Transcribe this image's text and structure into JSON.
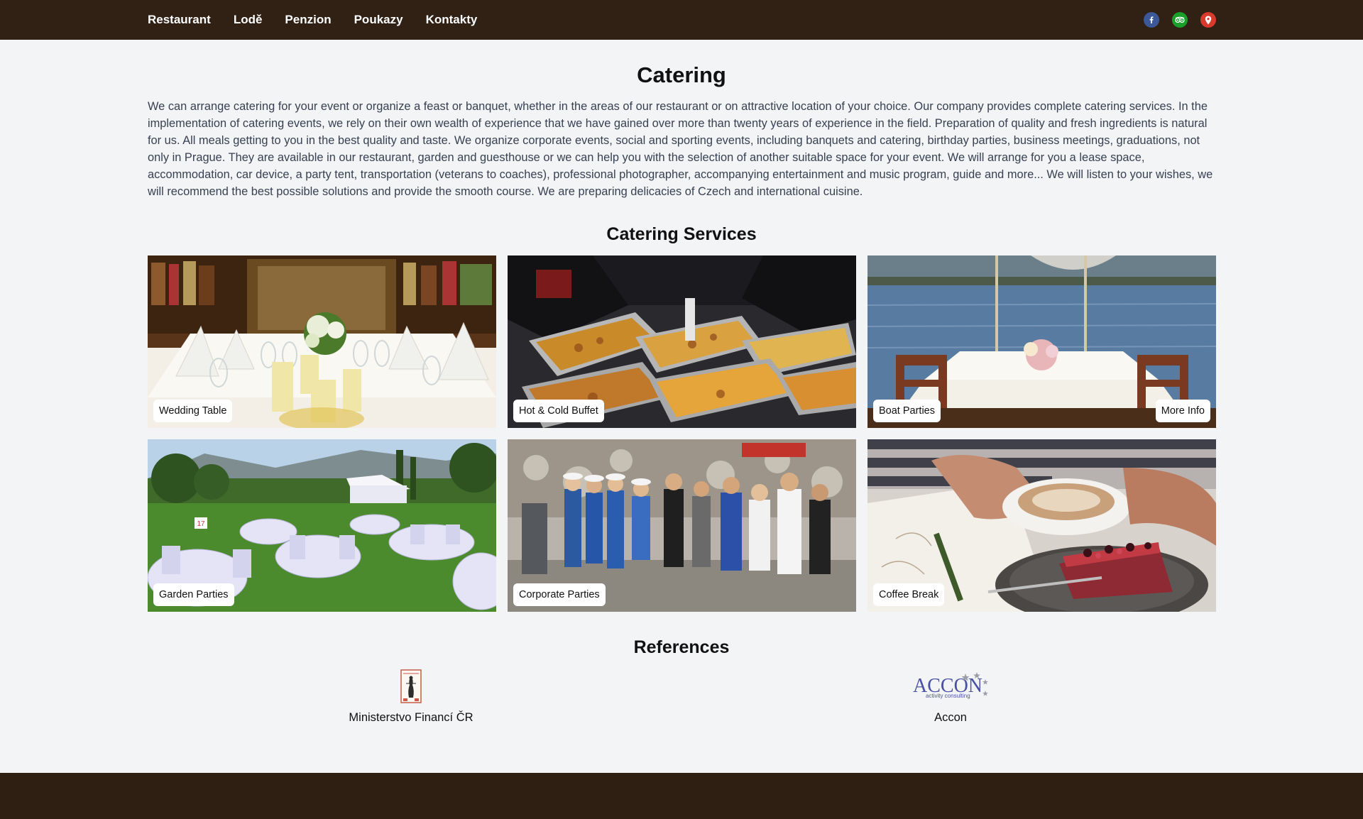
{
  "nav": {
    "items": [
      "Restaurant",
      "Lodě",
      "Penzion",
      "Poukazy",
      "Kontakty"
    ],
    "social": [
      {
        "icon": "facebook-icon",
        "color": "#3b5998"
      },
      {
        "icon": "tripadvisor-icon",
        "color": "#1a9f2a"
      },
      {
        "icon": "map-pin-icon",
        "color": "#d93a2b"
      }
    ]
  },
  "page": {
    "title": "Catering",
    "intro": "We can arrange catering for your event or organize a feast or banquet, whether in the areas of our restaurant or on attractive location of your choice. Our company provides complete catering services. In the implementation of catering events, we rely on their own wealth of experience that we have gained over more than twenty years of experience in the field. Preparation of quality and fresh ingredients is natural for us. All meals getting to you in the best quality and taste. We organize corporate events, social and sporting events, including banquets and catering, birthday parties, business meetings, graduations, not only in Prague. They are available in our restaurant, garden and guesthouse or we can help you with the selection of another suitable space for your event. We will arrange for you a lease space, accommodation, car device, a party tent, transportation (veterans to coaches), professional photographer, accompanying entertainment and music program, guide and more... We will listen to your wishes, we will recommend the best possible solutions and provide the smooth course. We are preparing delicacies of Czech and international cuisine."
  },
  "services": {
    "heading": "Catering Services",
    "more_label": "More Info",
    "items": [
      {
        "label": "Wedding Table"
      },
      {
        "label": "Hot & Cold Buffet"
      },
      {
        "label": "Boat Parties"
      },
      {
        "label": "Garden Parties"
      },
      {
        "label": "Corporate Parties"
      },
      {
        "label": "Coffee Break"
      }
    ]
  },
  "references": {
    "heading": "References",
    "items": [
      {
        "name": "Ministerstvo Financí ČR"
      },
      {
        "name": "Accon",
        "logo_text": "ACCON",
        "logo_sub": "activity consulting"
      }
    ]
  },
  "colors": {
    "header_bg": "#312115",
    "page_bg": "#f3f4f6",
    "footer_bg": "#2f1f12"
  }
}
